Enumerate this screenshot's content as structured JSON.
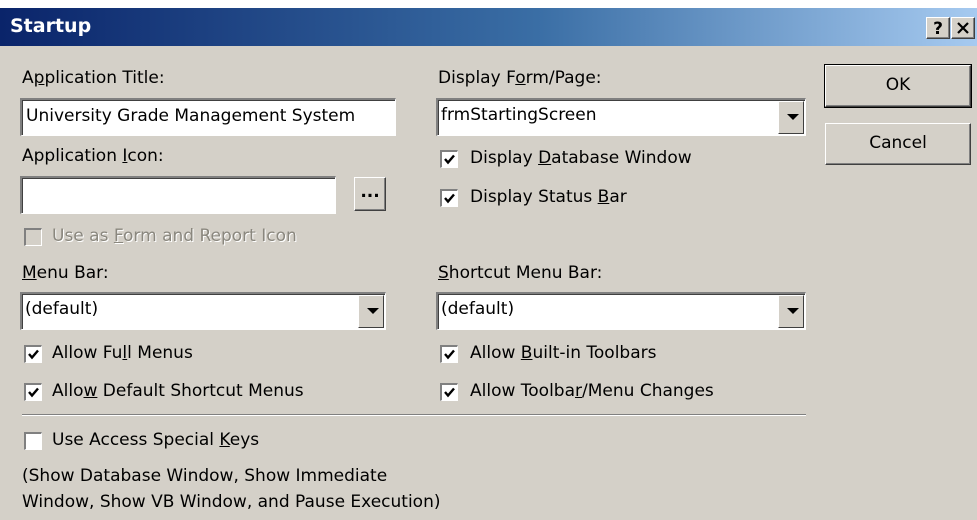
{
  "window": {
    "title": "Startup",
    "help_label": "?",
    "close_label": "✕"
  },
  "app_title": {
    "label_pre": "A",
    "label_ul": "p",
    "label_post": "plication Title:",
    "value": "University Grade Management System"
  },
  "app_icon": {
    "label_pre": "Application ",
    "label_ul": "I",
    "label_post": "con:",
    "value": "",
    "browse_label": "..."
  },
  "use_as_icon": {
    "label_pre": "Use as ",
    "label_ul": "F",
    "label_post": "orm and Report Icon",
    "checked": false
  },
  "menu_bar": {
    "label_pre": "",
    "label_ul": "M",
    "label_post": "enu Bar:",
    "value": "(default)"
  },
  "allow_full_menus": {
    "label_pre": "Allow Fu",
    "label_ul": "l",
    "label_post": "l Menus",
    "checked": true
  },
  "allow_default_shortcut": {
    "label_pre": "Allo",
    "label_ul": "w",
    "label_post": " Default Shortcut Menus",
    "checked": true
  },
  "display_form": {
    "label_pre": "Display F",
    "label_ul": "o",
    "label_post": "rm/Page:",
    "value": "frmStartingScreen"
  },
  "display_db_window": {
    "label_pre": "Display ",
    "label_ul": "D",
    "label_post": "atabase Window",
    "checked": true
  },
  "display_status_bar": {
    "label_pre": "Display Status ",
    "label_ul": "B",
    "label_post": "ar",
    "checked": true
  },
  "shortcut_menu_bar": {
    "label_pre": "",
    "label_ul": "S",
    "label_post": "hortcut Menu Bar:",
    "value": "(default)"
  },
  "allow_builtin_toolbars": {
    "label_pre": "Allow ",
    "label_ul": "B",
    "label_post": "uilt-in Toolbars",
    "checked": true
  },
  "allow_toolbar_changes": {
    "label_pre": "Allow Toolba",
    "label_ul": "r",
    "label_post": "/Menu Changes",
    "checked": true
  },
  "special_keys": {
    "label_pre": "Use Access Special ",
    "label_ul": "K",
    "label_post": "eys",
    "checked": false,
    "note_line1": "(Show Database Window, Show Immediate",
    "note_line2": "Window, Show VB Window, and Pause Execution)"
  },
  "buttons": {
    "ok": "OK",
    "cancel": "Cancel"
  }
}
